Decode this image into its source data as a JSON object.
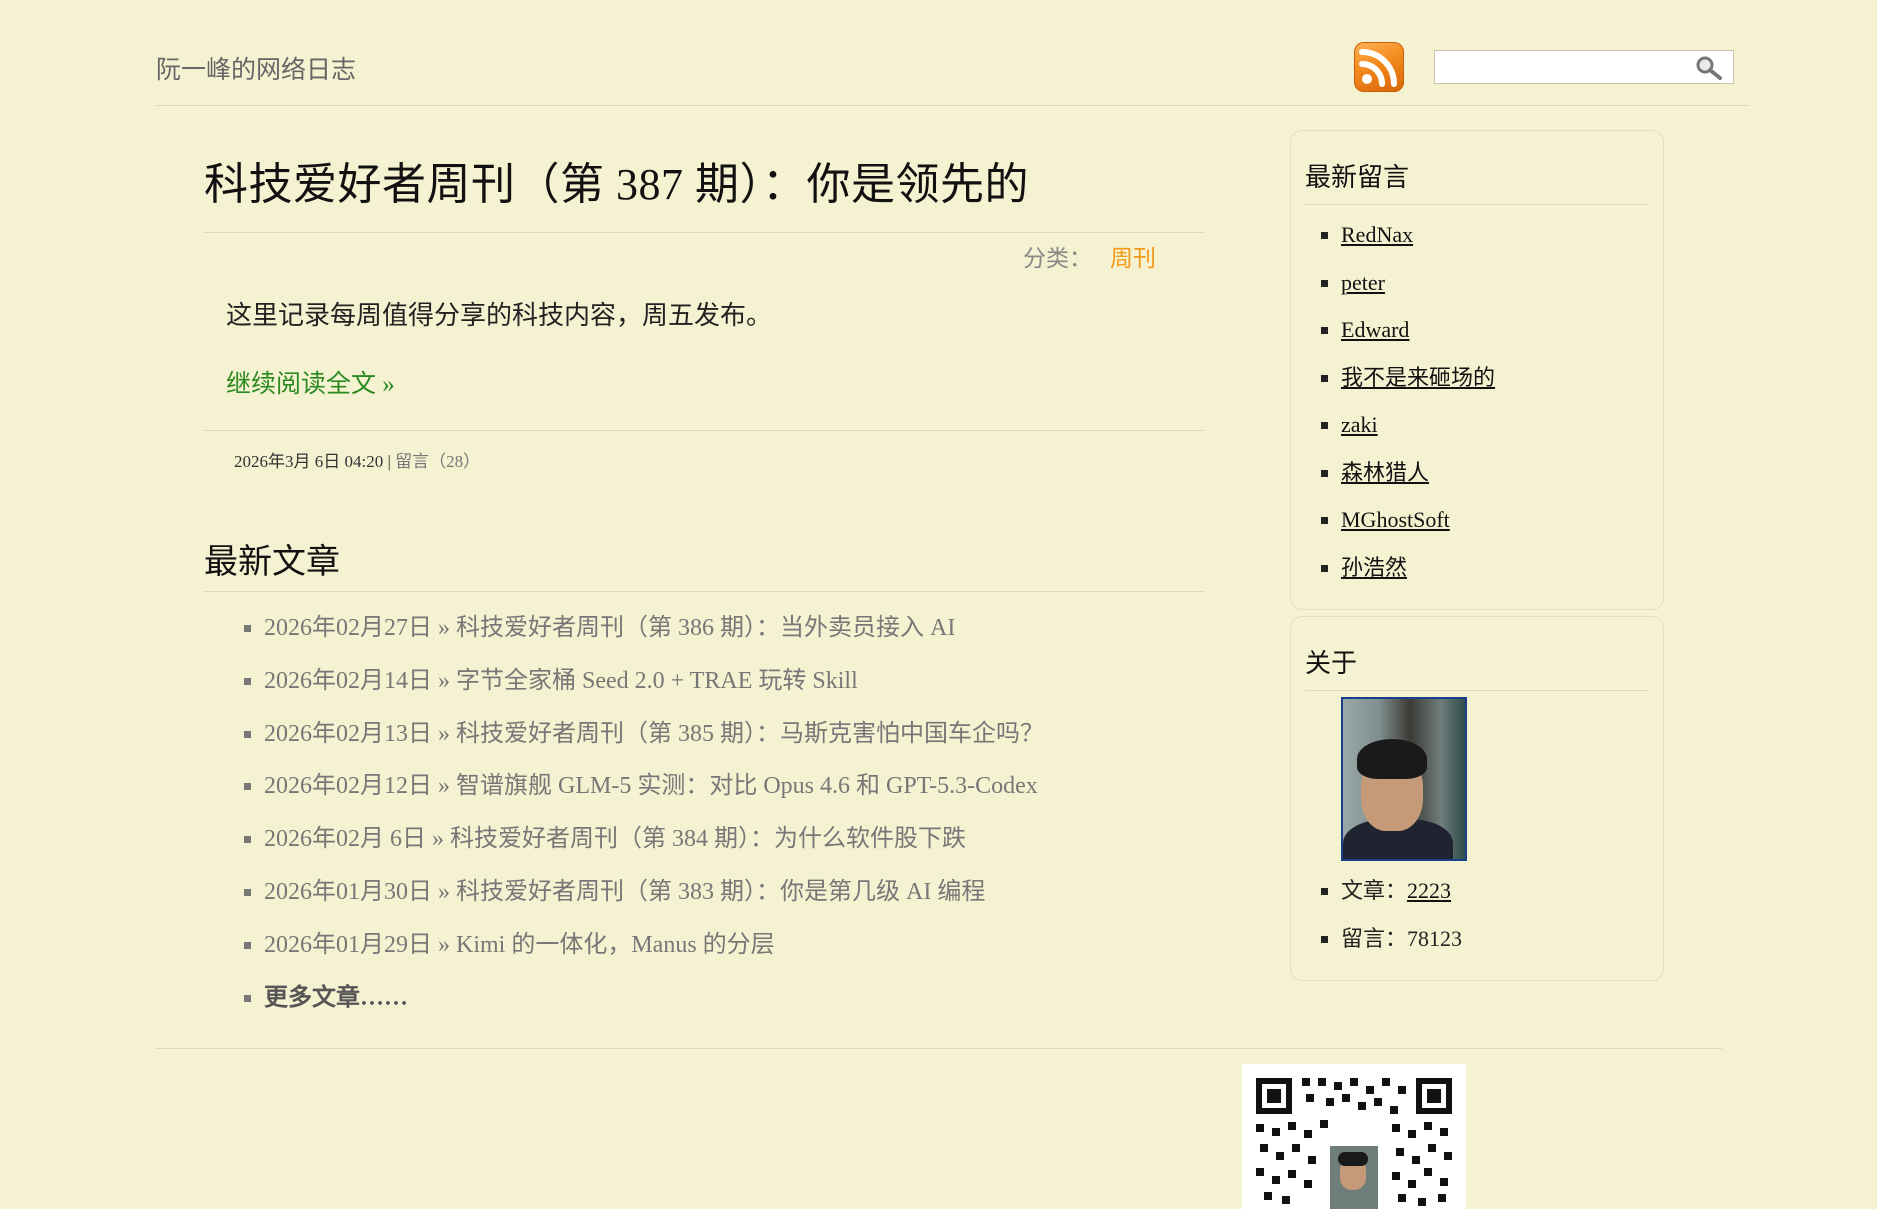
{
  "header": {
    "site_title": "阮一峰的网络日志",
    "search_value": ""
  },
  "post": {
    "title": "科技爱好者周刊（第 387 期）：你是领先的",
    "category_label": "分类：",
    "category": "周刊",
    "summary": "这里记录每周值得分享的科技内容，周五发布。",
    "read_more": "继续阅读全文 »",
    "date": "2026年3月 6日 04:20",
    "separator": "|",
    "comments": "留言（28）"
  },
  "recent": {
    "heading": "最新文章",
    "items": [
      {
        "date": "2026年02月27日",
        "title": "科技爱好者周刊（第 386 期）：当外卖员接入 AI"
      },
      {
        "date": "2026年02月14日",
        "title": "字节全家桶 Seed 2.0 + TRAE 玩转 Skill"
      },
      {
        "date": "2026年02月13日",
        "title": "科技爱好者周刊（第 385 期）：马斯克害怕中国车企吗？"
      },
      {
        "date": "2026年02月12日",
        "title": "智谱旗舰 GLM-5 实测：对比 Opus 4.6 和 GPT-5.3-Codex"
      },
      {
        "date": "2026年02月 6日",
        "title": "科技爱好者周刊（第 384 期）：为什么软件股下跌"
      },
      {
        "date": "2026年01月30日",
        "title": "科技爱好者周刊（第 383 期）：你是第几级 AI 编程"
      },
      {
        "date": "2026年01月29日",
        "title": "Kimi 的一体化，Manus 的分层"
      }
    ],
    "arrow": "»",
    "more": "更多文章……"
  },
  "sidebar": {
    "comments_heading": "最新留言",
    "commenters": [
      "RedNax",
      "peter",
      "Edward",
      "我不是来砸场的",
      "zaki",
      "森林猎人",
      "MGhostSoft",
      "孙浩然"
    ],
    "about_heading": "关于",
    "articles_label": "文章：",
    "articles_count": "2223",
    "comments_label": "留言：",
    "comments_count": "78123"
  },
  "icons": {
    "rss": "rss-icon",
    "search": "search-icon",
    "qr": "qr-code-icon"
  },
  "colors": {
    "background": "#f5f2d1",
    "category": "#f29a18",
    "read_more": "#2a8a20"
  }
}
